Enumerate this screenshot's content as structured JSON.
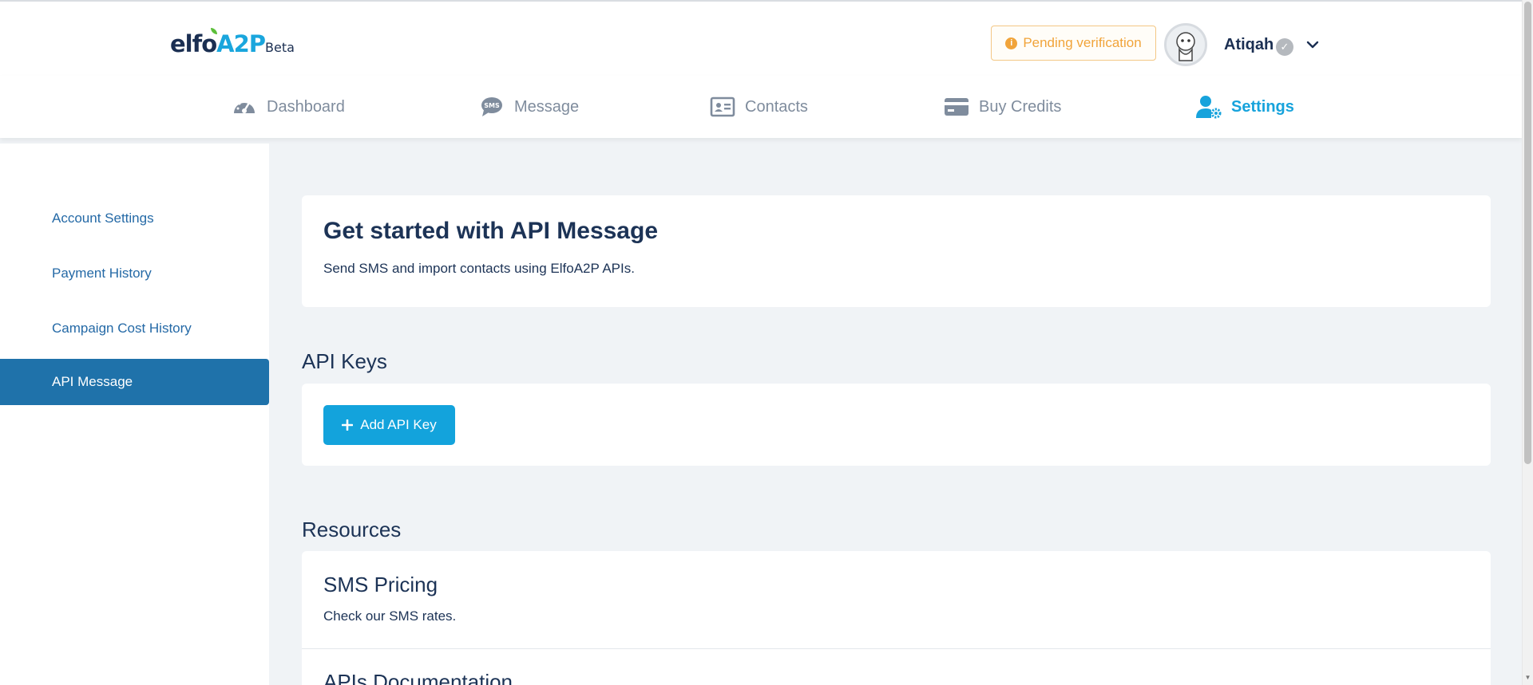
{
  "header": {
    "logo_main": "elfo",
    "logo_accent": "A2P",
    "logo_beta": "Beta",
    "pending_label": "Pending verification",
    "username": "Atiqah"
  },
  "nav": {
    "items": [
      {
        "label": "Dashboard",
        "icon": "dashboard-gauge-icon"
      },
      {
        "label": "Message",
        "icon": "sms-bubble-icon"
      },
      {
        "label": "Contacts",
        "icon": "contact-card-icon"
      },
      {
        "label": "Buy Credits",
        "icon": "credit-card-icon"
      },
      {
        "label": "Settings",
        "icon": "user-gear-icon",
        "active": true
      }
    ]
  },
  "sidebar": {
    "items": [
      {
        "label": "Account Settings"
      },
      {
        "label": "Payment History"
      },
      {
        "label": "Campaign Cost History"
      },
      {
        "label": "API Message",
        "active": true
      }
    ]
  },
  "main": {
    "title": "Get started with API Message",
    "subtitle": "Send SMS and import contacts using ElfoA2P APIs.",
    "api_keys_heading": "API Keys",
    "add_api_key_label": "Add API Key",
    "resources_heading": "Resources",
    "resources": [
      {
        "title": "SMS Pricing",
        "desc": "Check our SMS rates."
      },
      {
        "title": "APIs Documentation"
      }
    ]
  },
  "colors": {
    "accent": "#13a3dc",
    "sidebar_active": "#1f72aa",
    "pending": "#f1a43a",
    "navy": "#1c3356"
  }
}
